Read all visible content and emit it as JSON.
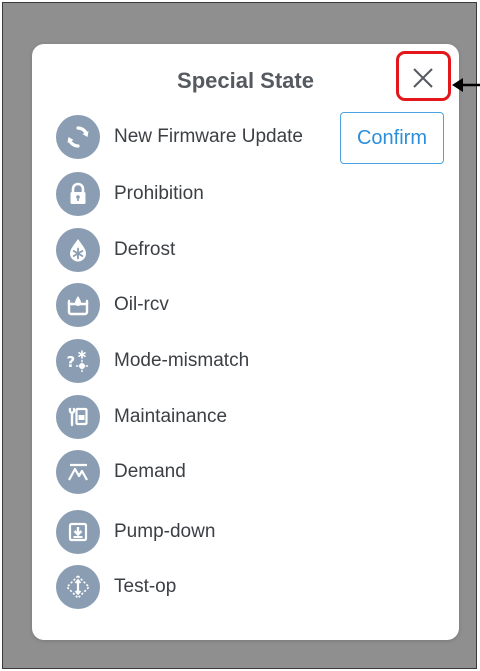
{
  "dialog": {
    "title": "Special State",
    "close_icon": "close-x-icon",
    "highlight_color": "#e3161c",
    "arrow_icon": "arrow-left-icon"
  },
  "confirm_button": {
    "label": "Confirm",
    "color": "#2d8fd9"
  },
  "states": [
    {
      "label": "New Firmware Update",
      "icon": "sync-icon"
    },
    {
      "label": "Prohibition",
      "icon": "lock-icon"
    },
    {
      "label": "Defrost",
      "icon": "snowflake-drop-icon"
    },
    {
      "label": "Oil-rcv",
      "icon": "oil-recovery-icon"
    },
    {
      "label": "Mode-mismatch",
      "icon": "mode-mismatch-icon"
    },
    {
      "label": "Maintainance",
      "icon": "maintenance-icon"
    },
    {
      "label": "Demand",
      "icon": "demand-icon"
    },
    {
      "label": "Pump-down",
      "icon": "pump-down-icon"
    },
    {
      "label": "Test-op",
      "icon": "test-op-icon"
    }
  ],
  "colors": {
    "backdrop": "#8f8f8f",
    "icon_circle": "#8a9db2",
    "text": "#3c3f44"
  }
}
